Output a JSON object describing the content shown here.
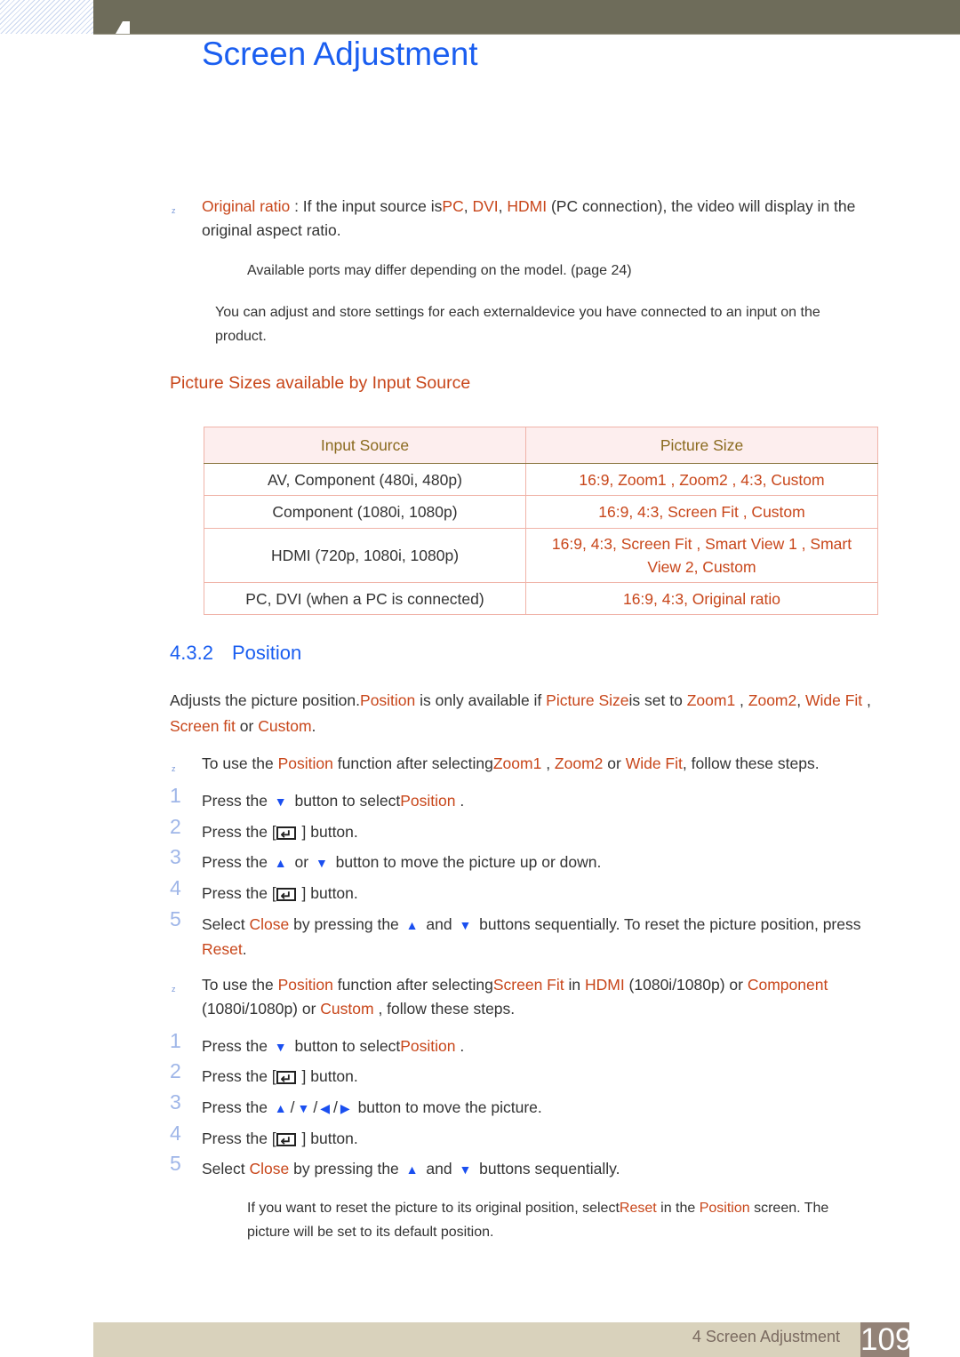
{
  "header": {
    "chapter_title": "Screen Adjustment"
  },
  "intro": {
    "original_ratio": {
      "term": "Original ratio",
      "text1": " : If the input source is",
      "sources": [
        "PC",
        "DVI",
        "HDMI"
      ],
      "text2": " (PC connection), the video will display in the",
      "line2": "original aspect ratio."
    },
    "ports_note": "Available ports may differ depending on the model. (page 24)",
    "store_note_line1": "You can adjust and store settings for each externaldevice you have connected to an input on the",
    "store_note_line2": "product."
  },
  "table_section": {
    "heading": "Picture Sizes available by Input Source",
    "columns": [
      "Input Source",
      "Picture Size"
    ],
    "rows": [
      {
        "source": "AV, Component (480i, 480p)",
        "sizes": "16:9, Zoom1 , Zoom2 , 4:3, Custom"
      },
      {
        "source": "Component (1080i, 1080p)",
        "sizes": "16:9, 4:3, Screen Fit , Custom"
      },
      {
        "source": "HDMI (720p, 1080i, 1080p)",
        "sizes_line1": "16:9, 4:3, Screen Fit , Smart View 1 , Smart",
        "sizes_line2": "View 2, Custom"
      },
      {
        "source": "PC, DVI (when a PC is connected)",
        "sizes": "16:9, 4:3, Original ratio"
      }
    ]
  },
  "position_section": {
    "number": "4.3.2",
    "title": "Position",
    "desc": {
      "t1": "Adjusts the picture position.",
      "position": "Position",
      "t2": "  is only available if ",
      "picture_size": "Picture Size",
      "t3": "is set to ",
      "zoom1": "Zoom1",
      "zoom2": "Zoom2",
      "wide_fit": "Wide Fit",
      "screen_fit": "Screen fit",
      "t4": "  or ",
      "custom": "Custom",
      "end": "."
    },
    "group1": {
      "intro": {
        "t1": "To use the ",
        "position": "Position",
        "t2": "  function after selecting",
        "zoom1": "Zoom1",
        "zoom2": "Zoom2",
        "t3": "  or ",
        "wide_fit": "Wide Fit",
        "t4": ", follow these steps."
      },
      "steps": [
        {
          "n": "1",
          "a": "Press the ",
          "b": " button to select",
          "c": "Position",
          "d": " ."
        },
        {
          "n": "2",
          "a": "Press the [",
          "b": " ] button."
        },
        {
          "n": "3",
          "a": "Press the ",
          "b": " or ",
          "c": " button to move the picture up or down."
        },
        {
          "n": "4",
          "a": "Press the [",
          "b": " ] button."
        },
        {
          "n": "5",
          "a": "Select ",
          "close": "Close",
          "b": " by pressing the ",
          "c": " and ",
          "d": " buttons sequentially. To reset the picture position, press",
          "reset": "Reset",
          "e": "."
        }
      ]
    },
    "group2": {
      "intro": {
        "t1": "To use the ",
        "position": "Position",
        "t2": "  function after selecting",
        "screen_fit": "Screen Fit",
        "t3": "  in ",
        "hdmi": "HDMI",
        "t4": "  (1080i/1080p) or ",
        "component": "Component",
        "t5": "(1080i/1080p) or ",
        "custom": "Custom",
        "t6": " , follow these steps."
      },
      "steps": [
        {
          "n": "1",
          "a": "Press the ",
          "b": " button to select",
          "c": "Position",
          "d": " ."
        },
        {
          "n": "2",
          "a": "Press the [",
          "b": " ] button."
        },
        {
          "n": "3",
          "a": "Press the ",
          "b": " button to move the picture."
        },
        {
          "n": "4",
          "a": "Press the [",
          "b": " ] button."
        },
        {
          "n": "5",
          "a": "Select ",
          "close": "Close",
          "b": " by pressing the ",
          "c": " and ",
          "d": " buttons sequentially."
        }
      ]
    },
    "reset_note": {
      "t1": "If you want to reset the picture to its original position, select",
      "reset": "Reset",
      "t2": " in the ",
      "position": "Position",
      "t3": " screen. The",
      "line2": "picture will be set to its default position."
    }
  },
  "icons": {
    "up": "▲",
    "down": "▼",
    "left": "◀",
    "right": "▶",
    "bullet": "z"
  },
  "footer": {
    "label": "4 Screen Adjustment",
    "page_number": "109"
  },
  "colors": {
    "accent_blue": "#1a5ef0",
    "highlight_orange": "#c8461a",
    "header_bar": "#6e6c5a",
    "footer_bar": "#d9d2bc",
    "page_box": "#938277"
  }
}
